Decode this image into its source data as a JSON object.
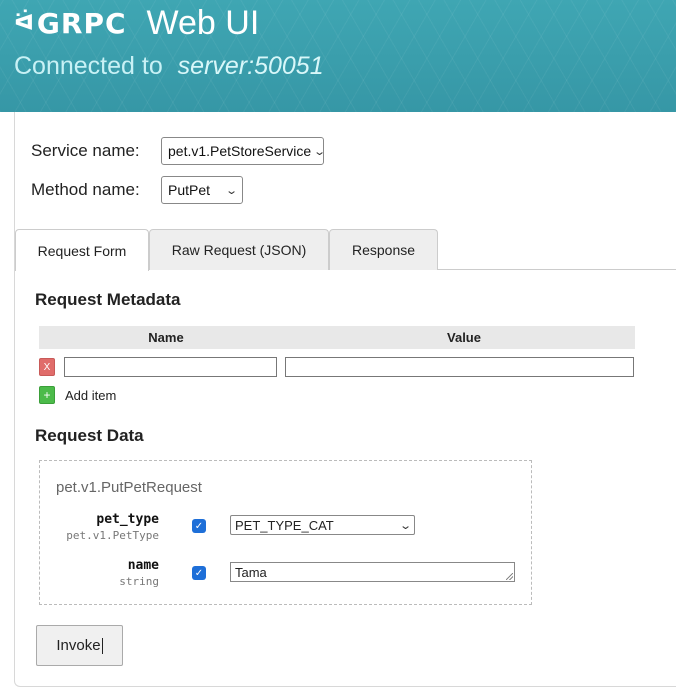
{
  "header": {
    "logo_text": "GRPC",
    "title": "Web UI",
    "connected_label": "Connected to",
    "server": "server:50051"
  },
  "form": {
    "service_label": "Service name:",
    "service_value": "pet.v1.PetStoreService",
    "method_label": "Method name:",
    "method_value": "PutPet"
  },
  "tabs": [
    {
      "label": "Request Form",
      "active": true
    },
    {
      "label": "Raw Request (JSON)",
      "active": false
    },
    {
      "label": "Response",
      "active": false
    }
  ],
  "metadata": {
    "title": "Request Metadata",
    "col_name": "Name",
    "col_value": "Value",
    "remove_label": "X",
    "add_symbol": "+",
    "add_label": "Add item",
    "rows": [
      {
        "name": "",
        "value": ""
      }
    ]
  },
  "request_data": {
    "title": "Request Data",
    "message_type": "pet.v1.PutPetRequest",
    "fields": [
      {
        "name": "pet_type",
        "type": "pet.v1.PetType",
        "checked": true,
        "value": "PET_TYPE_CAT"
      },
      {
        "name": "name",
        "type": "string",
        "checked": true,
        "value": "Tama"
      }
    ]
  },
  "invoke_label": "Invoke",
  "colors": {
    "header_bg": "#3a9fae",
    "remove_btn": "#e06c6a",
    "add_btn": "#4cbb4a",
    "checkbox": "#1e6fd8"
  },
  "icons": {
    "dropdown": "chevron-down-icon",
    "checkbox": "checkmark-icon"
  }
}
